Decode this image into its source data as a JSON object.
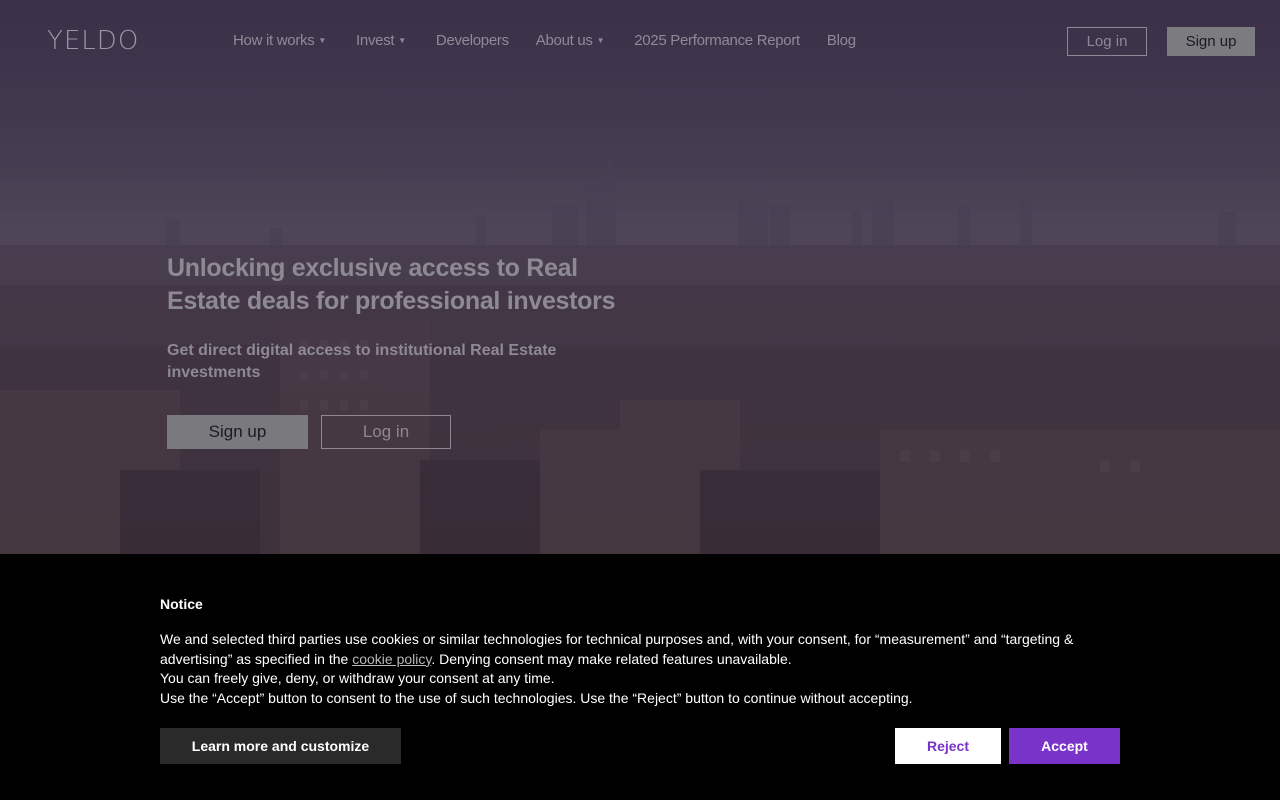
{
  "header": {
    "logo": "YELDO",
    "nav": [
      {
        "label": "How it works",
        "dropdown": true
      },
      {
        "label": "Invest",
        "dropdown": true
      },
      {
        "label": "Developers",
        "dropdown": false
      },
      {
        "label": "About us",
        "dropdown": true
      },
      {
        "label": "2025 Performance Report",
        "dropdown": false
      },
      {
        "label": "Blog",
        "dropdown": false
      }
    ],
    "login_label": "Log in",
    "signup_label": "Sign up"
  },
  "hero": {
    "title": "Unlocking exclusive access to Real Estate deals for professional investors",
    "subtitle": "Get direct digital access to institutional Real Estate investments",
    "signup_label": "Sign up",
    "login_label": "Log in"
  },
  "notice": {
    "title": "Notice",
    "line1_before": "We and selected third parties use cookies or similar technologies for technical purposes and, with your consent, for “measurement” and “targeting & advertising” as specified in the ",
    "link_label": "cookie policy",
    "line1_after": ". Denying consent may make related features unavailable.",
    "line2": "You can freely give, deny, or withdraw your consent at any time.",
    "line3": "Use the “Accept” button to consent to the use of such technologies. Use the “Reject” button to continue without accepting.",
    "learn_label": "Learn more and customize",
    "reject_label": "Reject",
    "accept_label": "Accept"
  },
  "colors": {
    "accent": "#7a33c9",
    "notice_bg": "#000000"
  }
}
